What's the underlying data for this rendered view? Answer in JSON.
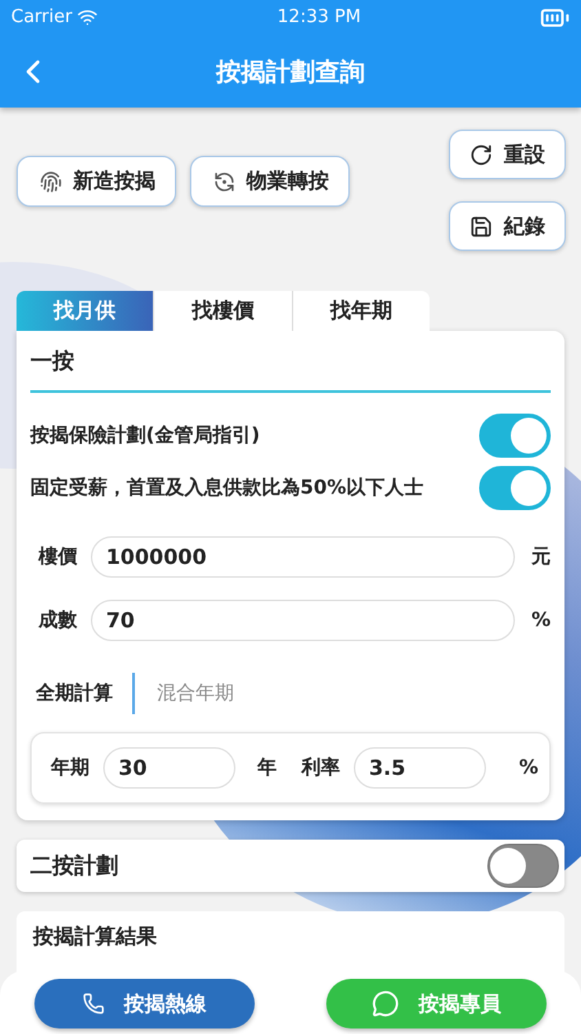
{
  "status_bar": {
    "carrier": "Carrier",
    "time": "12:33 PM"
  },
  "header": {
    "title": "按揭計劃查詢"
  },
  "actions": [
    {
      "label": "新造按揭",
      "kind": "new"
    },
    {
      "label": "物業轉按",
      "kind": "transfer"
    }
  ],
  "side_actions": [
    {
      "label": "重設",
      "kind": "reset"
    },
    {
      "label": "紀錄",
      "kind": "save"
    }
  ],
  "tabs": [
    {
      "label": "找月供",
      "selected": true
    },
    {
      "label": "找樓價",
      "selected": false
    },
    {
      "label": "找年期",
      "selected": false
    }
  ],
  "first_mortgage": {
    "title": "一按",
    "toggles": [
      {
        "label": "按揭保險計劃(金管局指引)",
        "on": true
      },
      {
        "label": "固定受薪，首置及入息供款比為50%以下人士",
        "on": true
      }
    ],
    "fields": [
      {
        "label": "樓價",
        "value": "1000000",
        "unit": "元"
      },
      {
        "label": "成數",
        "value": "70",
        "unit": "%"
      }
    ],
    "modes": [
      {
        "label": "全期計算",
        "selected": true
      },
      {
        "label": "混合年期",
        "selected": false
      }
    ],
    "term": {
      "label": "年期",
      "value": "30",
      "unit": "年"
    },
    "rate": {
      "label": "利率",
      "value": "3.5",
      "unit": "%"
    }
  },
  "second_mortgage": {
    "title": "二按計劃",
    "on": false
  },
  "result": {
    "title": "按揭計算結果"
  },
  "bottom_buttons": [
    {
      "label": "按揭熱線",
      "kind": "phone"
    },
    {
      "label": "按揭專員",
      "kind": "whatsapp"
    }
  ]
}
